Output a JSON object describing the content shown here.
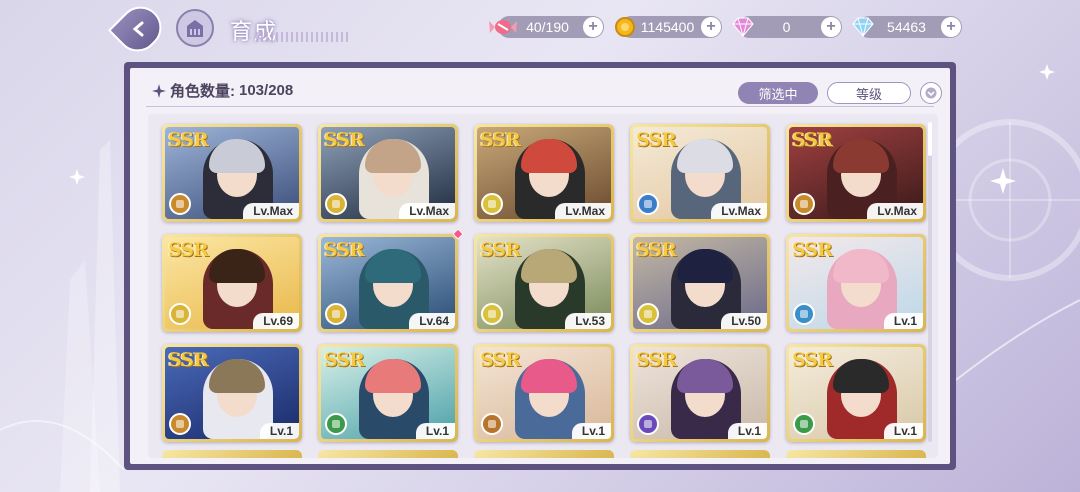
{
  "header": {
    "title": "育成",
    "resources": [
      {
        "name": "stamina",
        "value": "40/190",
        "icon": "candy-icon"
      },
      {
        "name": "gold",
        "value": "1145400",
        "icon": "coin-icon"
      },
      {
        "name": "paid-gem",
        "value": "0",
        "icon": "pink-diamond-icon"
      },
      {
        "name": "gem",
        "value": "54463",
        "icon": "blue-diamond-icon"
      }
    ]
  },
  "panel": {
    "count_label": "角色数量:",
    "count_value": "103/208",
    "filter_label": "筛选中",
    "sort_label": "等级"
  },
  "cards": [
    {
      "rarity": "SSR",
      "level": "Lv.Max",
      "role_color": "#c98a2c",
      "hair": "#c9ccd6",
      "bg1": "#3a4e7a",
      "bg2": "#9fb4d8",
      "coat": "#2d2d3a"
    },
    {
      "rarity": "SSR",
      "level": "Lv.Max",
      "role_color": "#d9b437",
      "hair": "#c4a488",
      "bg1": "#1f2b3f",
      "bg2": "#8ea0b8",
      "coat": "#e7e2da"
    },
    {
      "rarity": "SSR",
      "level": "Lv.Max",
      "role_color": "#d9c23a",
      "hair": "#cf4a3c",
      "bg1": "#6a4a2e",
      "bg2": "#c8a878",
      "coat": "#2a2a2a"
    },
    {
      "rarity": "SSR",
      "level": "Lv.Max",
      "role_color": "#3a7ec9",
      "hair": "#dcdce4",
      "bg1": "#e4c7a0",
      "bg2": "#f4ead8",
      "coat": "#58667c"
    },
    {
      "rarity": "SSR",
      "level": "Lv.Max",
      "role_color": "#c98a2c",
      "hair": "#8a3a30",
      "bg1": "#3a1a1a",
      "bg2": "#a04040",
      "coat": "#4a2020"
    },
    {
      "rarity": "SSR",
      "level": "Lv.69",
      "role_color": "#d9b437",
      "hair": "#3a2418",
      "bg1": "#e9b84a",
      "bg2": "#fbe6a4",
      "coat": "#6a2a2a"
    },
    {
      "rarity": "SSR",
      "level": "Lv.64",
      "role_color": "#d9b437",
      "hair": "#2e6a7a",
      "bg1": "#2a4c74",
      "bg2": "#9ab8d8",
      "coat": "#2a5a6a",
      "new": true
    },
    {
      "rarity": "SSR",
      "level": "Lv.53",
      "role_color": "#d9c23a",
      "hair": "#b8a878",
      "bg1": "#7a8a5a",
      "bg2": "#e4e2c8",
      "coat": "#2a3a2a"
    },
    {
      "rarity": "SSR",
      "level": "Lv.50",
      "role_color": "#d9c23a",
      "hair": "#1e2240",
      "bg1": "#6a6a8a",
      "bg2": "#c4b8a4",
      "coat": "#2a2a3a"
    },
    {
      "rarity": "SSR",
      "level": "Lv.1",
      "role_color": "#3a8ec9",
      "hair": "#f0b8c8",
      "bg1": "#bcd8e8",
      "bg2": "#f4e8ec",
      "coat": "#e8a8c0"
    },
    {
      "rarity": "SSR",
      "level": "Lv.1",
      "role_color": "#c98a2c",
      "hair": "#8a7858",
      "bg1": "#1a2a6a",
      "bg2": "#4a6ab8",
      "coat": "#e8e8f0"
    },
    {
      "rarity": "SSR",
      "level": "Lv.1",
      "role_color": "#3a9a4a",
      "hair": "#e87a7a",
      "bg1": "#4aa0a8",
      "bg2": "#d8f0e8",
      "coat": "#2a4a6a"
    },
    {
      "rarity": "SSR",
      "level": "Lv.1",
      "role_color": "#b8742a",
      "hair": "#e85a8a",
      "bg1": "#d8b89a",
      "bg2": "#f4e4d4",
      "coat": "#4a6a9a"
    },
    {
      "rarity": "SSR",
      "level": "Lv.1",
      "role_color": "#6a4ab8",
      "hair": "#7a5a9a",
      "bg1": "#c8b8a8",
      "bg2": "#efe4dc",
      "coat": "#3a2a4a"
    },
    {
      "rarity": "SSR",
      "level": "Lv.1",
      "role_color": "#3a9a4a",
      "hair": "#2a2a2a",
      "bg1": "#d8c8a8",
      "bg2": "#f4ecdc",
      "coat": "#a02a2a"
    }
  ]
}
